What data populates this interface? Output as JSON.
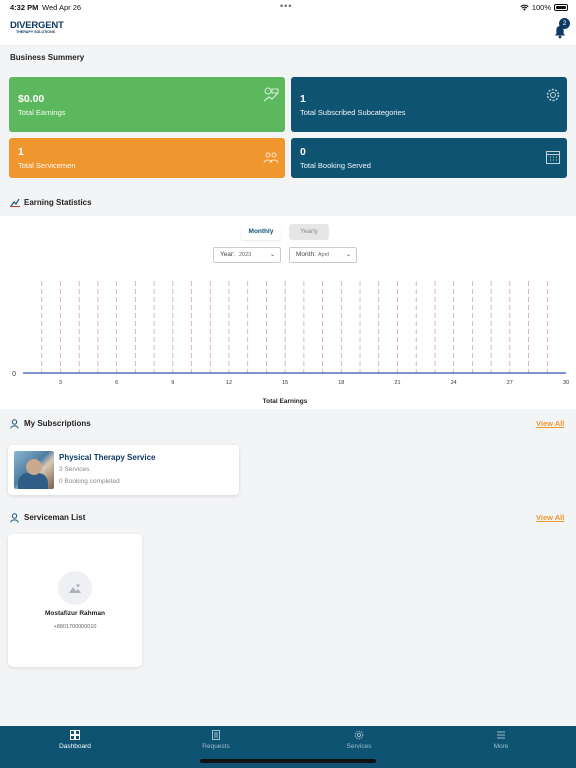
{
  "status": {
    "time": "4:32 PM",
    "date": "Wed Apr 26",
    "battery": "100%"
  },
  "header": {
    "brand": "DIVERGENT",
    "brand_sub": "THERAPY SOLUTIONS",
    "notification_count": "2"
  },
  "business": {
    "title": "Business Summery",
    "cards": [
      {
        "value": "$0.00",
        "label": "Total Earnings",
        "color": "#5cb85c",
        "icon": "money-icon"
      },
      {
        "value": "1",
        "label": "Total Subscribed Subcategories",
        "color": "#0e5372",
        "icon": "gear-icon"
      },
      {
        "value": "1",
        "label": "Total Servicemen",
        "color": "#f0962e",
        "icon": "team-icon"
      },
      {
        "value": "0",
        "label": "Total Booking Served",
        "color": "#0e5372",
        "icon": "calendar-icon"
      }
    ]
  },
  "earning": {
    "title": "Earning Statistics",
    "tab_monthly": "Monthly",
    "tab_yearly": "Yearly",
    "year_label": "Year:",
    "year_value": "2023",
    "month_label": "Month:",
    "month_value": "April"
  },
  "chart_data": {
    "type": "line",
    "x": [
      1,
      2,
      3,
      4,
      5,
      6,
      7,
      8,
      9,
      10,
      11,
      12,
      13,
      14,
      15,
      16,
      17,
      18,
      19,
      20,
      21,
      22,
      23,
      24,
      25,
      26,
      27,
      28,
      29,
      30
    ],
    "x_tick_labels": [
      "3",
      "6",
      "9",
      "12",
      "15",
      "18",
      "21",
      "24",
      "27",
      "30"
    ],
    "y_tick_labels": [
      "0"
    ],
    "series": [
      {
        "values": [
          0,
          0,
          0,
          0,
          0,
          0,
          0,
          0,
          0,
          0,
          0,
          0,
          0,
          0,
          0,
          0,
          0,
          0,
          0,
          0,
          0,
          0,
          0,
          0,
          0,
          0,
          0,
          0,
          0,
          0
        ]
      }
    ],
    "xlabel": "Total Earnings",
    "ylabel": "",
    "title": "",
    "grid": "vertical-dashed"
  },
  "subscriptions": {
    "title": "My Subscriptions",
    "view_all": "View All",
    "items": [
      {
        "name": "Physical Therapy Service",
        "services": "3 Services",
        "bookings": "0 Booking completed"
      }
    ]
  },
  "servicemen": {
    "title": "Serviceman List",
    "view_all": "View All",
    "items": [
      {
        "name": "Mostafizur Rahman",
        "phone": "+8801700000010"
      }
    ]
  },
  "tabs": [
    {
      "label": "Dashboard",
      "icon": "dashboard-icon",
      "active": true
    },
    {
      "label": "Requests",
      "icon": "requests-icon",
      "active": false
    },
    {
      "label": "Services",
      "icon": "services-icon",
      "active": false
    },
    {
      "label": "More",
      "icon": "menu-icon",
      "active": false
    }
  ]
}
